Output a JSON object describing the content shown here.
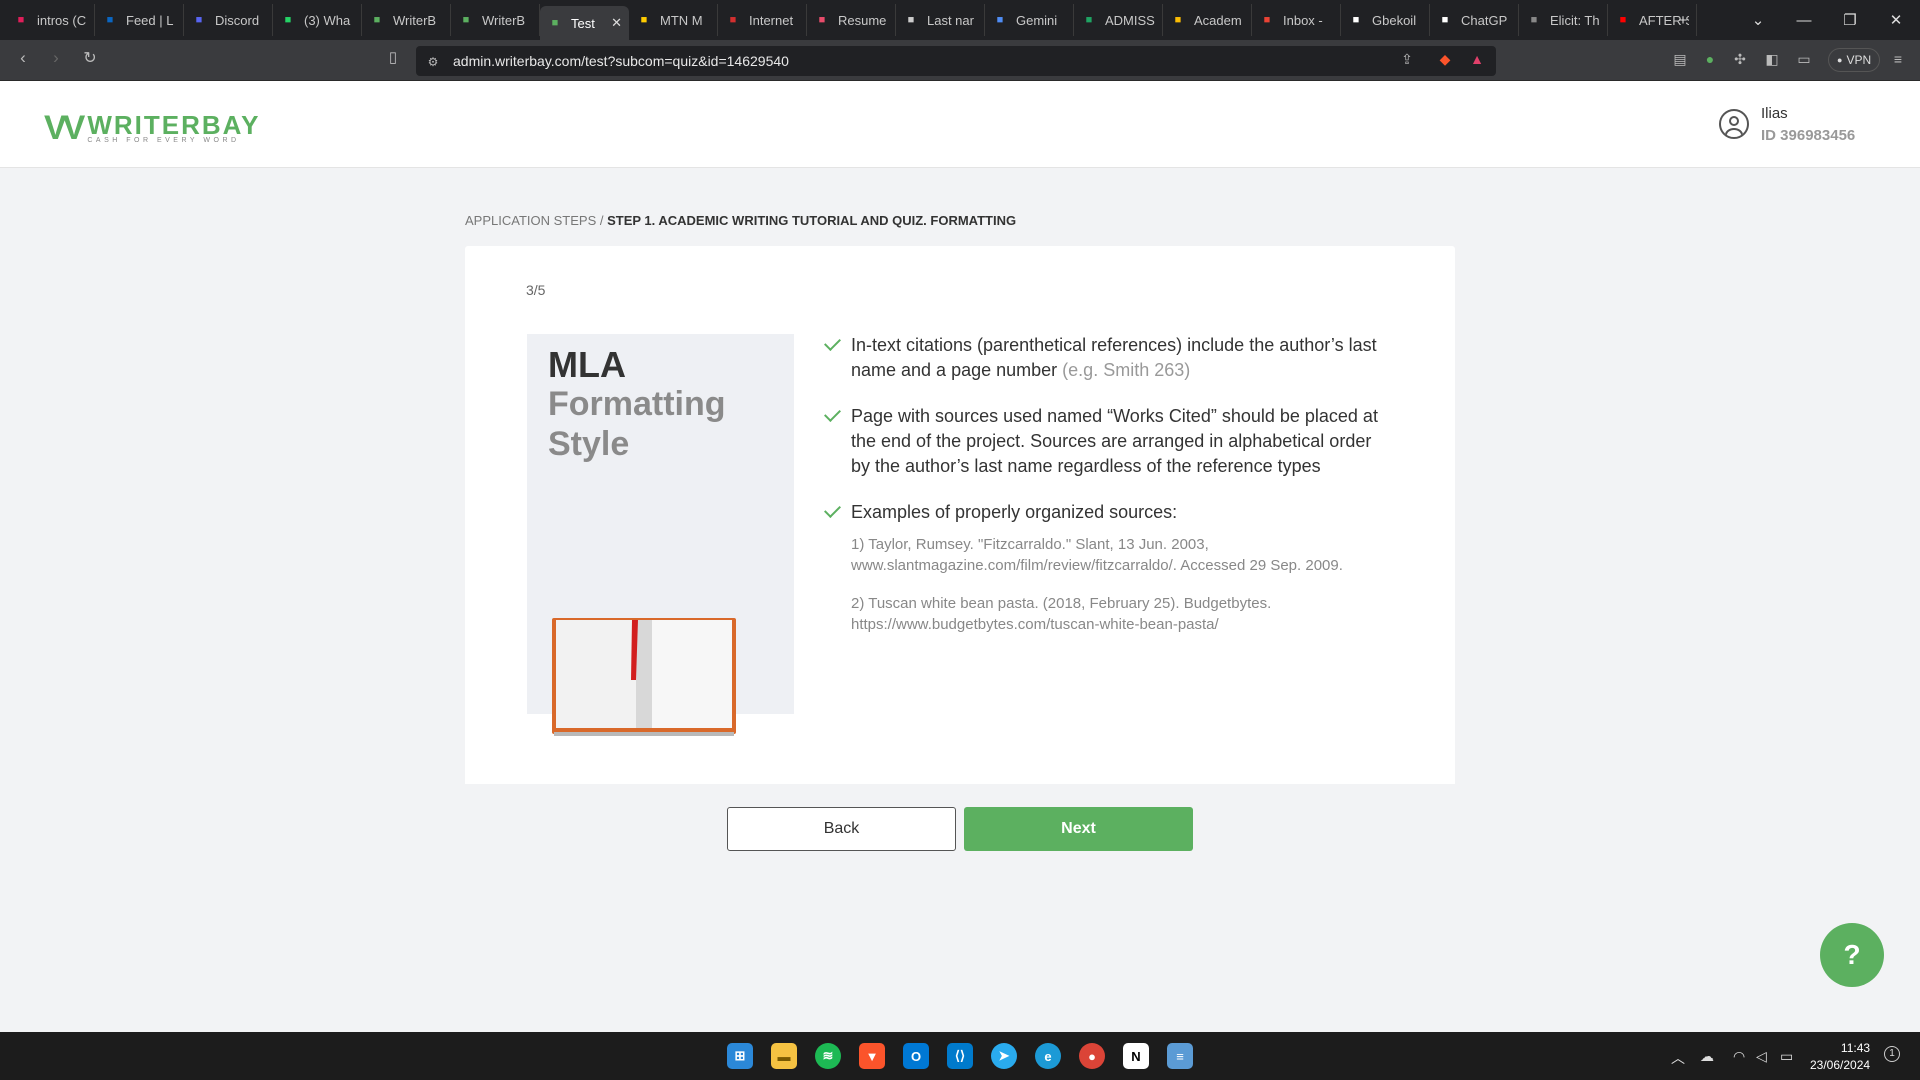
{
  "browser": {
    "tabs": [
      {
        "title": "intros (C",
        "icon": "slack-icon",
        "color": "#e01e5a"
      },
      {
        "title": "Feed | L",
        "icon": "linkedin-icon",
        "color": "#0a66c2"
      },
      {
        "title": "Discord",
        "icon": "discord-icon",
        "color": "#5865f2"
      },
      {
        "title": "(3) Wha",
        "icon": "whatsapp-icon",
        "color": "#25d366"
      },
      {
        "title": "WriterB",
        "icon": "writerbay-icon",
        "color": "#5cb060"
      },
      {
        "title": "WriterB",
        "icon": "writerbay-icon",
        "color": "#5cb060"
      },
      {
        "title": "Test",
        "icon": "writerbay-icon",
        "color": "#5cb060",
        "active": true
      },
      {
        "title": "MTN M",
        "icon": "mtn-icon",
        "color": "#ffcc00"
      },
      {
        "title": "Internet",
        "icon": "internet-icon",
        "color": "#d32f2f"
      },
      {
        "title": "Resume",
        "icon": "resume-icon",
        "color": "#e84c6b"
      },
      {
        "title": "Last nar",
        "icon": "gear-icon",
        "color": "#cccccc"
      },
      {
        "title": "Gemini",
        "icon": "gemini-icon",
        "color": "#4f8df5"
      },
      {
        "title": "ADMISS",
        "icon": "sheets-icon",
        "color": "#1fa463"
      },
      {
        "title": "Academ",
        "icon": "drive-icon",
        "color": "#fbbc04"
      },
      {
        "title": "Inbox -",
        "icon": "gmail-icon",
        "color": "#ea4335"
      },
      {
        "title": "Gbekoil",
        "icon": "github-icon",
        "color": "#ffffff"
      },
      {
        "title": "ChatGP",
        "icon": "chatgpt-icon",
        "color": "#ffffff"
      },
      {
        "title": "Elicit: Th",
        "icon": "elicit-icon",
        "color": "#888888"
      },
      {
        "title": "AFTER S",
        "icon": "youtube-icon",
        "color": "#ff0000"
      }
    ],
    "url": "admin.writerbay.com/test?subcom=quiz&id=14629540",
    "vpn_label": "VPN"
  },
  "site": {
    "logo_name": "WRITERBAY",
    "logo_tagline": "CASH FOR EVERY WORD",
    "user_name": "Ilias",
    "user_id": "ID 396983456"
  },
  "breadcrumb": {
    "root": "APPLICATION STEPS / ",
    "current": "STEP 1. ACADEMIC WRITING TUTORIAL AND QUIZ. FORMATTING"
  },
  "quiz": {
    "counter": "3/5",
    "title_line1": "MLA",
    "title_line2": "Formatting Style",
    "bullet1_text": "In-text citations (parenthetical references) include the author’s last name and a page number",
    "bullet1_example": "(e.g. Smith 263)",
    "bullet2_text": "Page with sources used named “Works Cited” should be placed at the end of the project. Sources are arranged in alphabetical order by the author’s last name regardless of the reference types",
    "bullet3_text": "Examples of properly organized sources:",
    "example1": "1) Taylor, Rumsey. \"Fitzcarraldo.\" Slant, 13 Jun. 2003, www.slantmagazine.com/film/review/fitzcarraldo/. Accessed 29 Sep. 2009.",
    "example2": "2) Tuscan white bean pasta. (2018, February 25). Budgetbytes. https://www.budgetbytes.com/tuscan-white-bean-pasta/",
    "back_label": "Back",
    "next_label": "Next"
  },
  "taskbar": {
    "time": "11:43",
    "date": "23/06/2024",
    "notification_count": "1"
  },
  "colors": {
    "accent": "#5cb060",
    "background": "#f2f3f5"
  }
}
